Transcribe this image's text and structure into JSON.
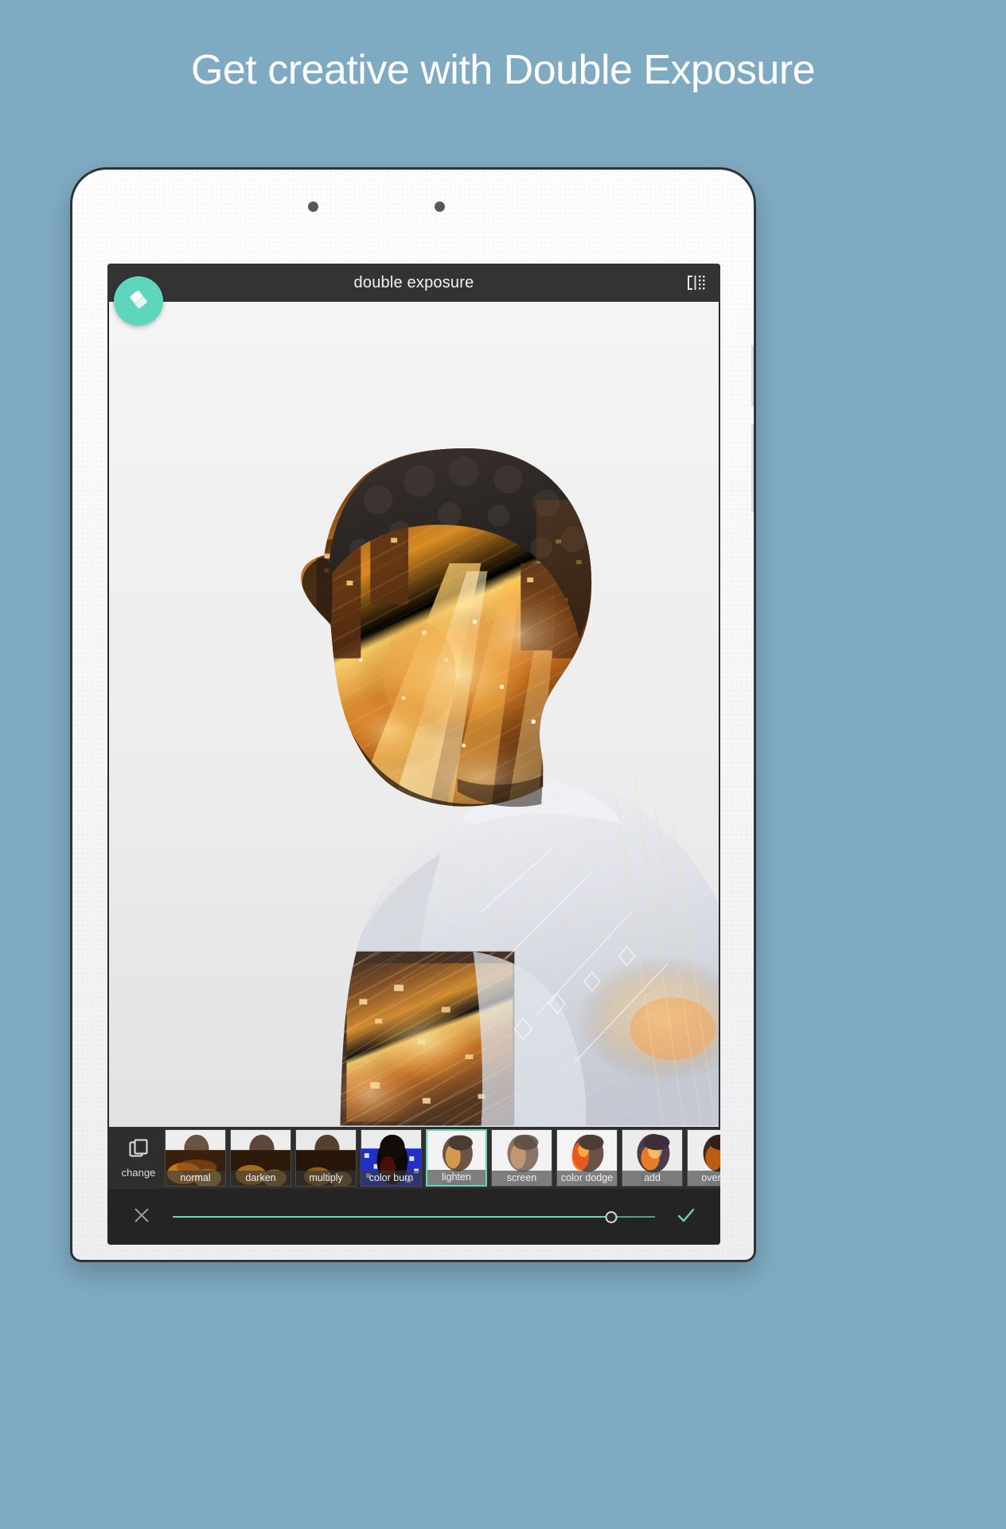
{
  "promo": {
    "headline": "Get creative with Double Exposure"
  },
  "colors": {
    "background": "#7fabc2",
    "accent": "#5ed6bd",
    "app_bar": "#333333",
    "toolbar": "#242424",
    "filter_strip": "#2e2e2e"
  },
  "app": {
    "header": {
      "title": "double exposure",
      "eraser_icon": "eraser-icon",
      "compare_icon": "compare-split-icon"
    },
    "canvas": {
      "description": "Double exposure portrait of a man in profile blended with night city street lights"
    },
    "filter_strip": {
      "change_button": {
        "label": "change",
        "icon": "photos-stack-icon"
      },
      "selected": "lighten",
      "blend_modes": [
        {
          "label": "normal",
          "selected": false
        },
        {
          "label": "darken",
          "selected": false
        },
        {
          "label": "multiply",
          "selected": false
        },
        {
          "label": "color burn",
          "selected": false
        },
        {
          "label": "lighten",
          "selected": true
        },
        {
          "label": "screen",
          "selected": false
        },
        {
          "label": "color dodge",
          "selected": false
        },
        {
          "label": "add",
          "selected": false
        },
        {
          "label": "overlay",
          "selected": false
        }
      ]
    },
    "bottom_bar": {
      "cancel_icon": "close-x-icon",
      "confirm_icon": "checkmark-icon",
      "opacity_slider": {
        "value": 91,
        "min": 0,
        "max": 100
      }
    }
  }
}
